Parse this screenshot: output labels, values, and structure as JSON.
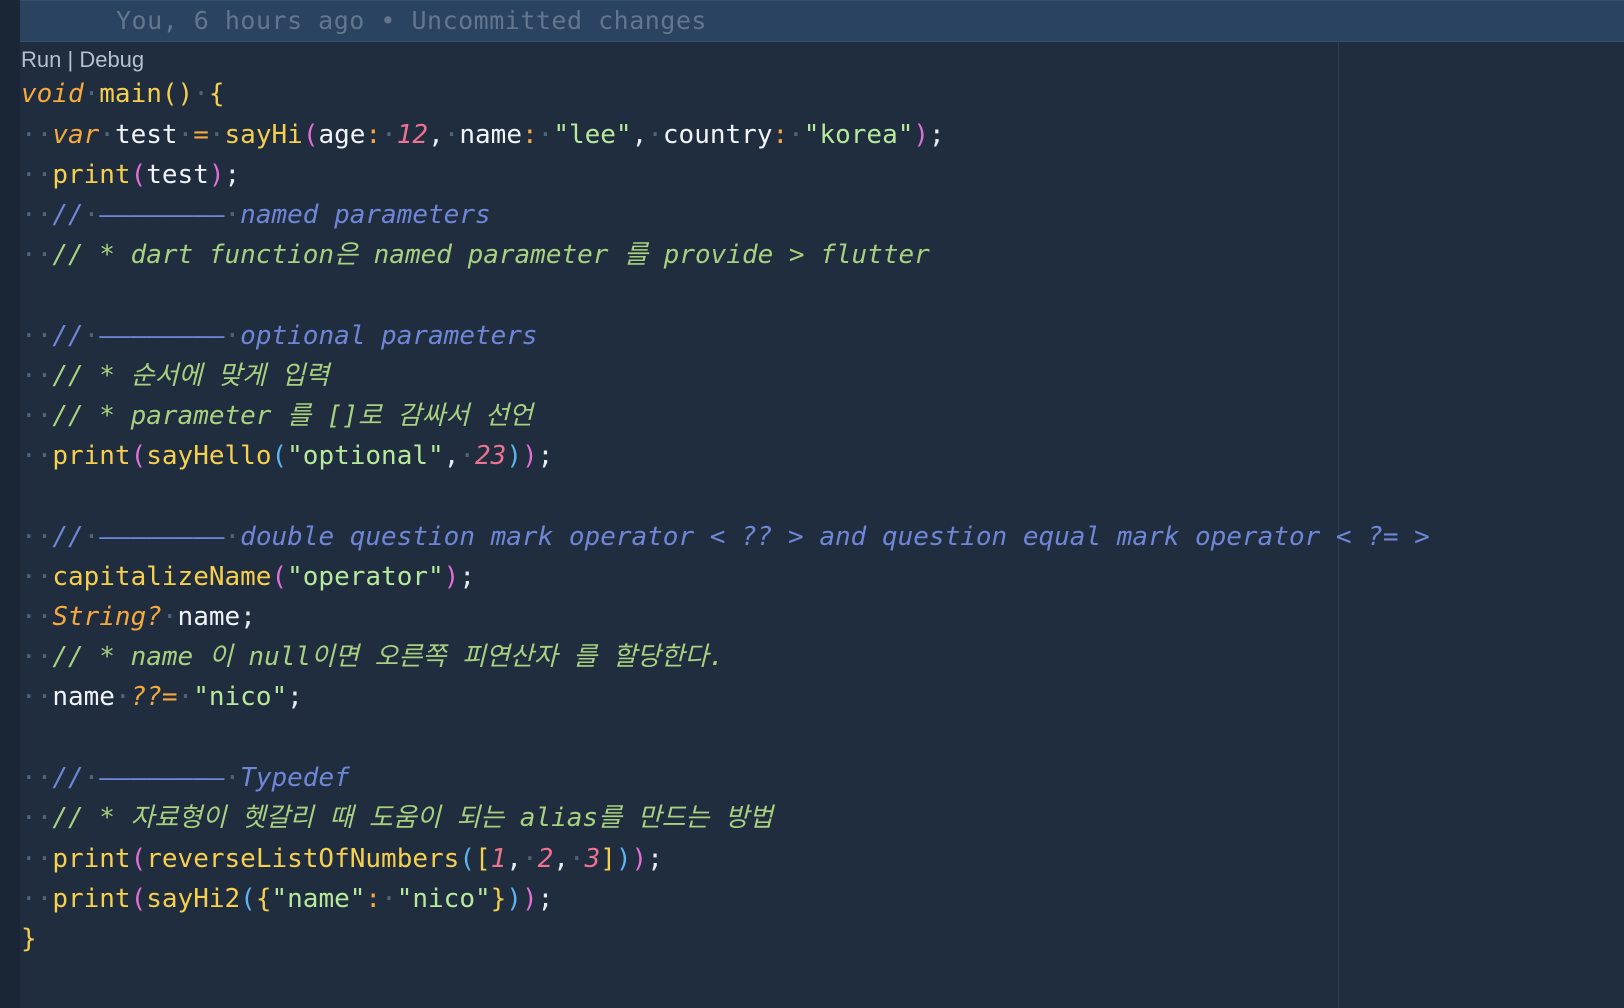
{
  "blame": "You, 6 hours ago • Uncommitted changes",
  "codelens": {
    "run": "Run",
    "separator": "|",
    "debug": "Debug"
  },
  "code": {
    "l1": {
      "kw": "void",
      "fn": "main",
      "open": "()",
      "brace": "{"
    },
    "l2": {
      "kw": "var",
      "name": "test",
      "eq": "=",
      "call": "sayHi",
      "p1": "age",
      "v1": "12",
      "p2": "name",
      "v2": "\"lee\"",
      "p3": "country",
      "v3": "\"korea\""
    },
    "l3": {
      "fn": "print",
      "arg": "test"
    },
    "l4": {
      "slashes": "//",
      "rule": "————————",
      "text": "named parameters"
    },
    "l5": {
      "text": "// * dart function은 named parameter 를 provide > flutter"
    },
    "l7": {
      "slashes": "//",
      "rule": "————————",
      "text": "optional parameters"
    },
    "l8": {
      "text": "// * 순서에 맞게 입력"
    },
    "l9": {
      "text": "// * parameter 를 []로 감싸서 선언"
    },
    "l10": {
      "fn": "print",
      "call": "sayHello",
      "s": "\"optional\"",
      "n": "23"
    },
    "l12": {
      "slashes": "//",
      "rule": "————————",
      "text": "double question mark operator < ?? > and question equal mark operator < ?= >"
    },
    "l13": {
      "fn": "capitalizeName",
      "s": "\"operator\""
    },
    "l14": {
      "type": "String?",
      "name": "name"
    },
    "l15": {
      "text": "// * name 이 null이면 오른쪽 피연산자 를 할당한다."
    },
    "l16": {
      "name": "name",
      "op": "??=",
      "s": "\"nico\""
    },
    "l18": {
      "slashes": "//",
      "rule": "————————",
      "text": "Typedef"
    },
    "l19": {
      "text": "// * 자료형이 헷갈리 때 도움이 되는 alias를 만드는 방법"
    },
    "l20": {
      "fn": "print",
      "call": "reverseListOfNumbers",
      "n1": "1",
      "n2": "2",
      "n3": "3"
    },
    "l21": {
      "fn": "print",
      "call": "sayHi2",
      "k": "\"name\"",
      "v": "\"nico\""
    },
    "l22": {
      "brace": "}"
    }
  }
}
